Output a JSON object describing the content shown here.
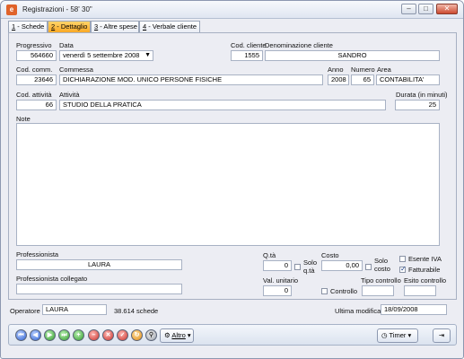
{
  "window": {
    "title": "Registrazioni - 58' 30\"",
    "icon": "app-icon",
    "controls": {
      "minimize": "–",
      "maximize": "□",
      "close": "✕"
    }
  },
  "tabs": [
    {
      "key": "1",
      "label": " - Schede"
    },
    {
      "key": "2",
      "label": " - Dettaglio"
    },
    {
      "key": "3",
      "label": " - Altre spese"
    },
    {
      "key": "4",
      "label": " - Verbale cliente"
    }
  ],
  "form": {
    "progressivo": {
      "label": "Progressivo",
      "value": "564660"
    },
    "data": {
      "label": "Data",
      "value": "venerdì 5 settembre 2008"
    },
    "cod_cliente": {
      "label": "Cod. cliente",
      "value": "1555"
    },
    "denominazione": {
      "label": "Denominazione cliente",
      "value": "SANDRO"
    },
    "cod_comm": {
      "label": "Cod. comm.",
      "value": "23646"
    },
    "commessa": {
      "label": "Commessa",
      "value": "DICHIARAZIONE MOD. UNICO PERSONE FISICHE"
    },
    "anno": {
      "label": "Anno",
      "value": "2008"
    },
    "numero": {
      "label": "Numero",
      "value": "65"
    },
    "area": {
      "label": "Area",
      "value": "CONTABILITA'"
    },
    "cod_attivita": {
      "label": "Cod. attività",
      "value": "66"
    },
    "attivita": {
      "label": "Attività",
      "value": "STUDIO DELLA PRATICA"
    },
    "durata": {
      "label": "Durata (in minuti)",
      "value": "25"
    },
    "note": {
      "label": "Note",
      "value": ""
    },
    "professionista": {
      "label": "Professionista",
      "value": "LAURA"
    },
    "professionista_collegato": {
      "label": "Professionista collegato",
      "value": ""
    },
    "qta": {
      "label": "Q.tà",
      "value": "0"
    },
    "solo_qta": {
      "label_1": "Solo",
      "label_2": "q.tà",
      "checked": false
    },
    "costo": {
      "label": "Costo",
      "value": "0,00"
    },
    "solo_costo": {
      "label_1": "Solo",
      "label_2": "costo",
      "checked": false
    },
    "esente_iva": {
      "label": "Esente IVA",
      "checked": false
    },
    "fatturabile": {
      "label": "Fatturabile",
      "checked": true
    },
    "val_unitario": {
      "label": "Val. unitario",
      "value": "0"
    },
    "controllo": {
      "label": "Controllo",
      "checked": false
    },
    "tipo_controllo": {
      "label": "Tipo controllo",
      "value": ""
    },
    "esito_controllo": {
      "label": "Esito controllo",
      "value": ""
    }
  },
  "status": {
    "operatore_label": "Operatore",
    "operatore_value": "LAURA",
    "schede_count": "38.614 schede",
    "ultima_modifica_label": "Ultima modifica",
    "ultima_modifica_value": "18/09/2008"
  },
  "toolbar": {
    "nav_buttons": [
      {
        "icon": "first-record-icon",
        "glyph": "⏮",
        "color": "blue"
      },
      {
        "icon": "previous-record-icon",
        "glyph": "◀",
        "color": "blue"
      },
      {
        "icon": "next-record-icon",
        "glyph": "▶",
        "color": "green"
      },
      {
        "icon": "last-record-icon",
        "glyph": "⏭",
        "color": "green"
      },
      {
        "icon": "new-record-icon",
        "glyph": "+",
        "color": "green"
      },
      {
        "icon": "delete-record-icon",
        "glyph": "–",
        "color": "red"
      },
      {
        "icon": "cancel-icon",
        "glyph": "✕",
        "color": "red"
      },
      {
        "icon": "confirm-icon",
        "glyph": "✓",
        "color": "red"
      },
      {
        "icon": "refresh-icon",
        "glyph": "↻",
        "color": "orange"
      },
      {
        "icon": "search-icon",
        "glyph": "⚲",
        "color": "grey"
      }
    ],
    "altro_label": "Altro",
    "timer_label": "Timer",
    "exit_icon": "exit-door-icon"
  }
}
